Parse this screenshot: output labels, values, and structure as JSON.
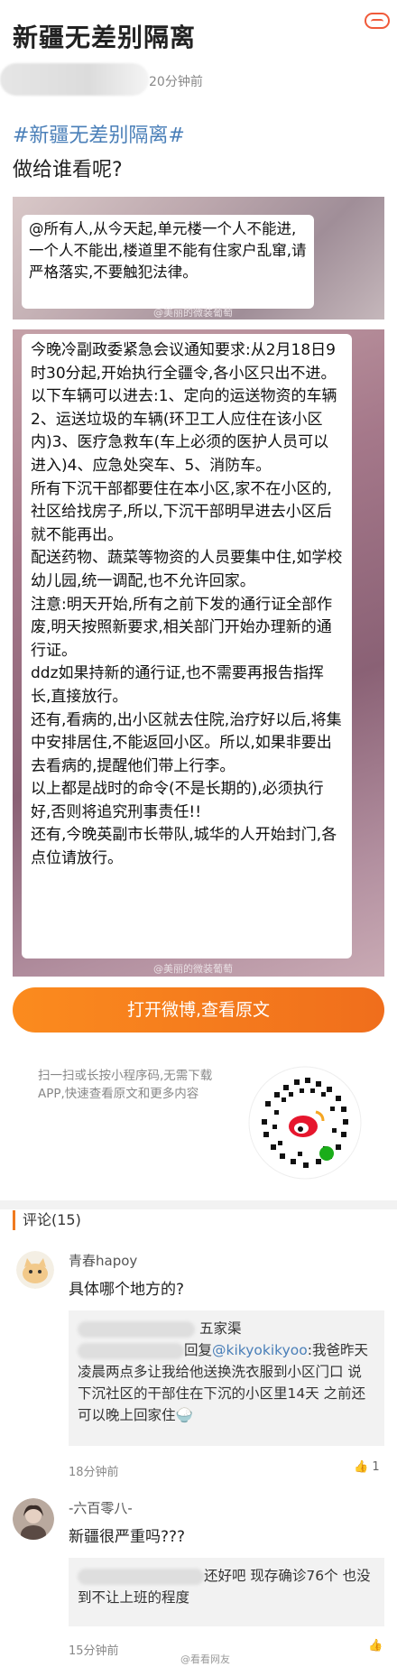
{
  "post": {
    "title": "新疆无差别隔离",
    "time": "20分钟前",
    "hashtag": "#新疆无差别隔离#",
    "text": "做给谁看呢?"
  },
  "image1": {
    "text": "@所有人,从今天起,单元楼一个人不能进,一个人不能出,楼道里不能有住家户乱窜,请严格落实,不要触犯法律。",
    "watermark": "@美丽的微装葡萄"
  },
  "image2": {
    "paragraphs": [
      "今晚冷副政委紧急会议通知要求:从2月18日9时30分起,开始执行全疆令,各小区只出不进。",
      "以下车辆可以进去:1、定向的运送物资的车辆2、运送垃圾的车辆(环卫工人应住在该小区内)3、医疗急救车(车上必须的医护人员可以进入)4、应急处突车、5、消防车。",
      "所有下沉干部都要住在本小区,家不在小区的,社区给找房子,所以,下沉干部明早进去小区后就不能再出。",
      "配送药物、蔬菜等物资的人员要集中住,如学校幼儿园,统一调配,也不允许回家。",
      "注意:明天开始,所有之前下发的通行证全部作废,明天按照新要求,相关部门开始办理新的通行证。",
      "ddz如果持新的通行证,也不需要再报告指挥长,直接放行。",
      "还有,看病的,出小区就去住院,治疗好以后,将集中安排居住,不能返回小区。所以,如果非要出去看病的,提醒他们带上行李。",
      "以上都是战时的命令(不是长期的),必须执行好,否则将追究刑事责任!!",
      "还有,今晚英副市长带队,城华的人开始封门,各点位请放行。"
    ],
    "watermark": "@美丽的微装葡萄"
  },
  "open_button": "打开微博,查看原文",
  "scan_tip": "扫一扫或长按小程序码,无需下载APP,快速查看原文和更多内容",
  "comments_header": "评论(15)",
  "comments": [
    {
      "user": "青春hapoy",
      "text": "具体哪个地方的?",
      "reply_user_suffix": "五家渠",
      "reply_prefix": "回复",
      "reply_mention": "@kikyokikyoo",
      "reply_text": ":我爸昨天凌晨两点多让我给他送换洗衣服到小区门口 说下沉社区的干部住在下沉的小区里14天 之前还可以晚上回家住",
      "time": "18分钟前",
      "likes": "1"
    },
    {
      "user": "-六百零八-",
      "text": "新疆很严重吗???",
      "reply_text": "还好吧 现存确诊76个 也没到不让上班的程度",
      "time": "15分钟前",
      "likes": ""
    }
  ],
  "bottom_watermark": "@看看网友",
  "colors": {
    "accent": "#f07a1f",
    "link": "#4a7fb8",
    "close": "#f05a3a"
  }
}
